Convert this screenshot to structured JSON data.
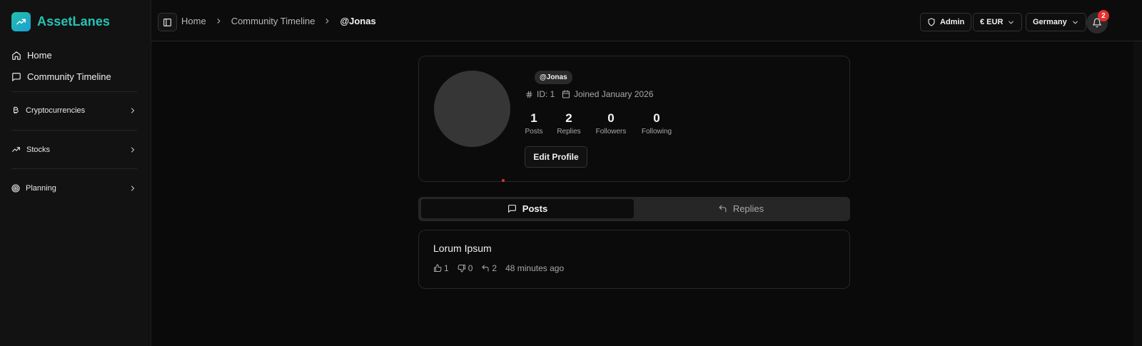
{
  "brand": {
    "name": "AssetLanes"
  },
  "sidebar": {
    "items": [
      {
        "label": "Home"
      },
      {
        "label": "Community Timeline"
      }
    ],
    "groups": [
      {
        "label": "Cryptocurrencies"
      },
      {
        "label": "Stocks"
      },
      {
        "label": "Planning"
      }
    ]
  },
  "breadcrumb": [
    "Home",
    "Community Timeline",
    "@Jonas"
  ],
  "topbar": {
    "admin_label": "Admin",
    "currency": "€ EUR",
    "country": "Germany",
    "notification_count": "2"
  },
  "profile": {
    "handle": "@Jonas",
    "id_text": "ID: 1",
    "joined": "Joined January 2026",
    "stats": [
      {
        "value": "1",
        "label": "Posts"
      },
      {
        "value": "2",
        "label": "Replies"
      },
      {
        "value": "0",
        "label": "Followers"
      },
      {
        "value": "0",
        "label": "Following"
      }
    ],
    "edit_label": "Edit Profile"
  },
  "tabs": [
    {
      "label": "Posts"
    },
    {
      "label": "Replies"
    }
  ],
  "posts": [
    {
      "title": "Lorum Ipsum",
      "likes": "1",
      "dislikes": "0",
      "replies": "2",
      "time": "48 minutes ago"
    }
  ],
  "colors": {
    "accent": "#26c3b5",
    "badge": "#e5302f",
    "background": "#0a0a0a"
  }
}
